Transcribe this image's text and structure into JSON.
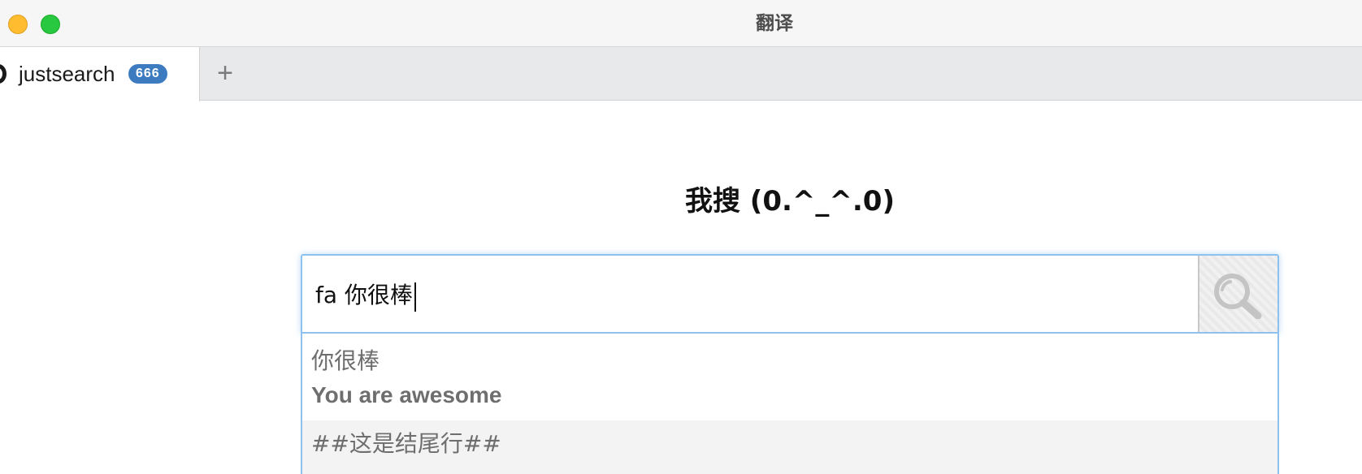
{
  "window": {
    "title": "翻译"
  },
  "tabs": [
    {
      "label": "justsearch",
      "badge": "666"
    }
  ],
  "new_tab_label": "+",
  "main": {
    "heading": "我搜 (0.^_^.0)",
    "search": {
      "value": "fa 你很棒",
      "button_icon": "magnifier-icon"
    },
    "suggestions": [
      {
        "text": "你很棒"
      },
      {
        "text": "You are awesome"
      },
      {
        "text": "##这是结尾行##"
      }
    ]
  },
  "colors": {
    "tab_badge": "#3d7bc0",
    "focus_border": "#8fc1ef",
    "traffic_yellow": "#febc2e",
    "traffic_green": "#28c840"
  }
}
